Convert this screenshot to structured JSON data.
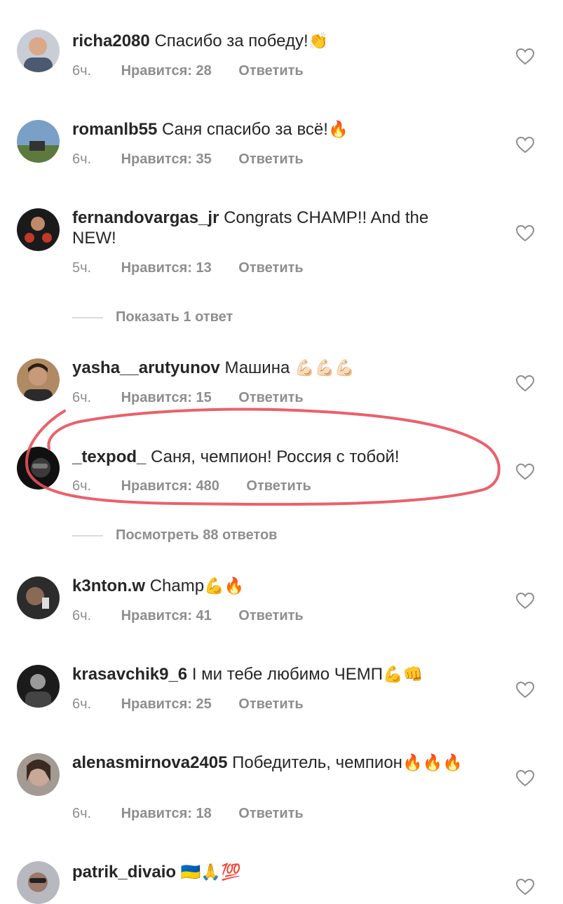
{
  "comments": [
    {
      "user": "richa2080",
      "text": "Спасибо за победу!",
      "emoji": "👏",
      "time": "6ч.",
      "likes": "Нравится: 28",
      "reply": "Ответить",
      "avatar_color": "#6b7a8f"
    },
    {
      "user": "romanlb55",
      "text": "Саня спасибо за всё!",
      "emoji": "🔥",
      "time": "6ч.",
      "likes": "Нравится: 35",
      "reply": "Ответить",
      "avatar_color": "#5b7fa8"
    },
    {
      "user": "fernandovargas_jr",
      "text": "Congrats CHAMP!! And the NEW!",
      "emoji": "",
      "time": "5ч.",
      "likes": "Нравится: 13",
      "reply": "Ответить",
      "avatar_color": "#2a2a2a"
    },
    {
      "user": "yasha__arutyunov",
      "text": "Машина",
      "emoji": "💪🏻💪🏻💪🏻",
      "time": "6ч.",
      "likes": "Нравится: 15",
      "reply": "Ответить",
      "avatar_color": "#6b4a2e"
    },
    {
      "user": "_texpod_",
      "text": "Саня, чемпион! Россия с тобой!",
      "emoji": "",
      "time": "6ч.",
      "likes": "Нравится: 480",
      "reply": "Ответить",
      "avatar_color": "#1e1e1e"
    },
    {
      "user": "k3nton.w",
      "text": "Champ",
      "emoji": "💪🔥",
      "time": "6ч.",
      "likes": "Нравится: 41",
      "reply": "Ответить",
      "avatar_color": "#3a3a3a"
    },
    {
      "user": "krasavchik9_6",
      "text": "І ми тебе любимо ЧЕМП",
      "emoji": "💪👊",
      "time": "6ч.",
      "likes": "Нравится: 25",
      "reply": "Ответить",
      "avatar_color": "#262626"
    },
    {
      "user": "alenasmirnova2405",
      "text": "Победитель, чемпион",
      "emoji": "🔥🔥🔥",
      "time": "6ч.",
      "likes": "Нравится: 18",
      "reply": "Ответить",
      "avatar_color": "#8a7f7a"
    },
    {
      "user": "patrik_divaio",
      "text": "",
      "emoji": "🇺🇦🙏💯",
      "time": "",
      "likes": "",
      "reply": "",
      "avatar_color": "#8a8a92"
    }
  ],
  "threads": [
    {
      "label": "Показать 1 ответ"
    },
    {
      "label": "Посмотреть 88 ответов"
    }
  ],
  "colors": {
    "muted": "#8e8e8e",
    "text": "#262626",
    "annotation": "#e8505b"
  }
}
